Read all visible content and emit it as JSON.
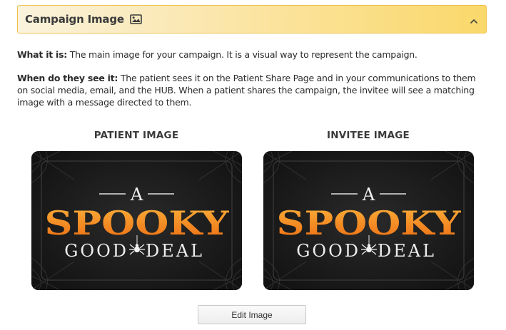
{
  "panel": {
    "title": "Campaign Image",
    "title_icon": "image-icon",
    "collapse_icon": "chevron-up-icon"
  },
  "description": {
    "what_label": "What it is:",
    "what_text": " The main image for your campaign. It is a visual way to represent the campaign.",
    "when_label": "When do they see it:",
    "when_text": " The patient sees it on the Patient Share Page and in your communications to them on social media, email, and the HUB. When a patient shares the campaign, the invitee will see a matching image with a message directed to them."
  },
  "images": [
    {
      "heading": "PATIENT IMAGE",
      "artwork": {
        "line1": "A",
        "line2": "SPOOKY",
        "line3_left": "GOOD",
        "line3_right": "DEAL"
      }
    },
    {
      "heading": "INVITEE IMAGE",
      "artwork": {
        "line1": "A",
        "line2": "SPOOKY",
        "line3_left": "GOOD",
        "line3_right": "DEAL"
      }
    }
  ],
  "actions": {
    "edit_label": "Edit Image"
  },
  "colors": {
    "header_gradient_start": "#faf2dc",
    "header_gradient_end": "#fad86a",
    "header_border": "#ecc24f",
    "artwork_orange": "#f28a1c",
    "artwork_background": "#1b1b1b"
  }
}
